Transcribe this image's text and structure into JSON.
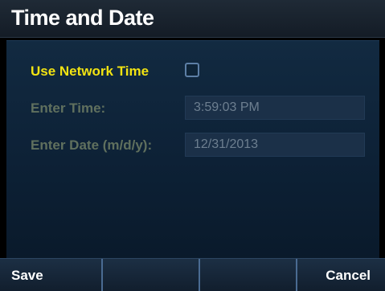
{
  "header": {
    "title": "Time and Date"
  },
  "form": {
    "network_time": {
      "label": "Use Network Time",
      "checked": false
    },
    "time": {
      "label": "Enter Time:",
      "value": "3:59:03 PM"
    },
    "date": {
      "label": "Enter Date (m/d/y):",
      "value": "12/31/2013"
    }
  },
  "softkeys": {
    "save": "Save",
    "key2": "",
    "key3": "",
    "cancel": "Cancel"
  },
  "colors": {
    "active_label": "#f2e312",
    "disabled_label": "#60705e",
    "background": "#0d2136"
  }
}
